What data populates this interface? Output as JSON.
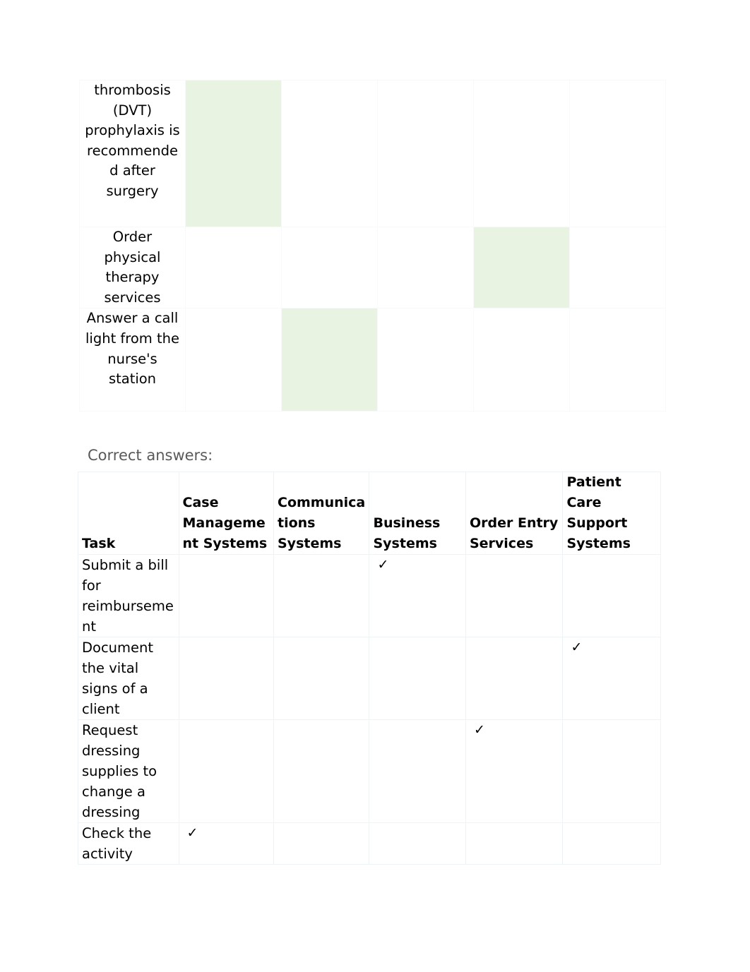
{
  "document": {
    "caption_correct_answers": "Correct answers:"
  },
  "top_table": {
    "columns": [
      "Task",
      "Case Management Systems",
      "Communications Systems",
      "Business Systems",
      "Order Entry Services",
      "Patient Care Support Systems"
    ],
    "rows": [
      {
        "task": "thrombosis (DVT) prophylaxis is recommended after surgery",
        "highlight_column": 1
      },
      {
        "task": "Order physical therapy services",
        "highlight_column": 4
      },
      {
        "task": "Answer a call light from the nurse's station",
        "highlight_column": 2
      }
    ],
    "highlight_color": "#e9f3e1"
  },
  "answer_table": {
    "headers": {
      "task": "Task",
      "case_management": "Case Management Systems",
      "communications": "Communications Systems",
      "business": "Business Systems",
      "order_entry": "Order Entry Services",
      "patient_care_support": "Patient Care Support Systems"
    },
    "check_glyph": "✓",
    "rows": [
      {
        "task": "Submit a bill for reimbursement",
        "case_management": "",
        "communications": "",
        "business": "✓",
        "order_entry": "",
        "patient_care_support": ""
      },
      {
        "task": "Document the vital signs of a client",
        "case_management": "",
        "communications": "",
        "business": "",
        "order_entry": "",
        "patient_care_support": "✓"
      },
      {
        "task": "Request dressing supplies to change a dressing",
        "case_management": "",
        "communications": "",
        "business": "",
        "order_entry": "✓",
        "patient_care_support": ""
      },
      {
        "task": "Check the activity",
        "case_management": "✓",
        "communications": "",
        "business": "",
        "order_entry": "",
        "patient_care_support": ""
      }
    ]
  }
}
